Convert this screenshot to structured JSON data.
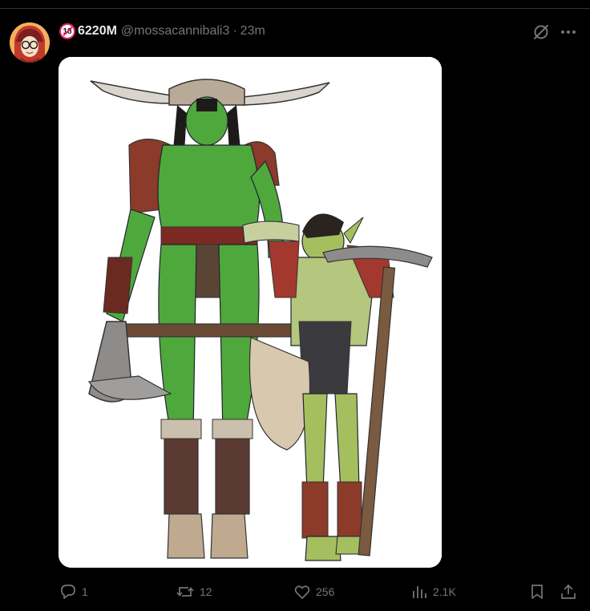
{
  "post": {
    "display_name": "6220M",
    "handle": "@mossacannibali3",
    "separator": "·",
    "time": "23m",
    "age_badge": "18"
  },
  "actions": {
    "replies": "1",
    "reposts": "12",
    "likes": "256",
    "views": "2.1K"
  },
  "icons": {
    "header": [
      "age-restricted-icon",
      "grok-icon",
      "more-icon"
    ],
    "actions": [
      "reply-icon",
      "repost-icon",
      "like-icon",
      "views-icon",
      "bookmark-icon",
      "share-icon"
    ]
  },
  "colors": {
    "background": "#000000",
    "primary_text": "#e7e9ea",
    "secondary_text": "#71767b",
    "divider": "#2f3336",
    "badge_red": "#e0245e"
  }
}
